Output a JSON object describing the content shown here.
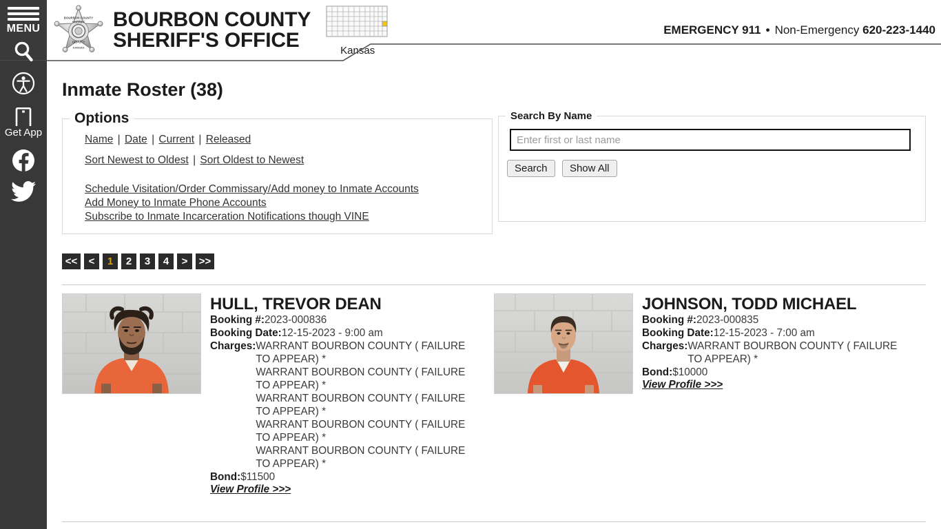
{
  "sidebar": {
    "menu_label": "MENU",
    "items": [
      {
        "name": "menu",
        "label": "MENU",
        "icon": "hamburger-icon"
      },
      {
        "name": "search",
        "label": "",
        "icon": "search-icon"
      },
      {
        "name": "accessibility",
        "label": "",
        "icon": "accessibility-icon"
      },
      {
        "name": "get-app",
        "label": "Get App",
        "icon": "mobile-app-icon"
      },
      {
        "name": "facebook",
        "label": "",
        "icon": "facebook-icon"
      },
      {
        "name": "twitter",
        "label": "",
        "icon": "twitter-icon"
      }
    ],
    "get_app_label": "Get App"
  },
  "header": {
    "badge_alt": "sheriff-star-badge",
    "title_line1": "BOURBON COUNTY",
    "title_line2": "SHERIFF'S OFFICE",
    "state_caption": "Kansas",
    "emergency_label": "EMERGENCY 911",
    "separator": "•",
    "non_emergency_label": "Non-Emergency",
    "non_emergency_number": "620-223-1440",
    "highlight_color": "#f0c419"
  },
  "page": {
    "title": "Inmate Roster (38)"
  },
  "options": {
    "legend": "Options",
    "filters": [
      {
        "label": "Name"
      },
      {
        "label": "Date"
      },
      {
        "label": "Current"
      },
      {
        "label": "Released"
      }
    ],
    "separator": "|",
    "sorts": [
      {
        "label": "Sort Newest to Oldest"
      },
      {
        "label": "Sort Oldest to Newest"
      }
    ],
    "links": [
      {
        "label": "Schedule Visitation/Order Commissary/Add money to Inmate Accounts"
      },
      {
        "label": "Add Money to Inmate Phone Accounts"
      },
      {
        "label": "Subscribe to Inmate Incarceration Notifications though VINE"
      }
    ]
  },
  "search": {
    "legend": "Search By Name",
    "placeholder": "Enter first or last name",
    "value": "",
    "search_button": "Search",
    "show_all_button": "Show All"
  },
  "pagination": {
    "active_color": "#d9a400",
    "items": [
      {
        "label": "<<",
        "active": false,
        "wide": true
      },
      {
        "label": "<",
        "active": false,
        "wide": false
      },
      {
        "label": "1",
        "active": true,
        "wide": false
      },
      {
        "label": "2",
        "active": false,
        "wide": false
      },
      {
        "label": "3",
        "active": false,
        "wide": false
      },
      {
        "label": "4",
        "active": false,
        "wide": false
      },
      {
        "label": ">",
        "active": false,
        "wide": false
      },
      {
        "label": ">>",
        "active": false,
        "wide": true
      }
    ]
  },
  "labels": {
    "booking_no": "Booking #:",
    "booking_date": "Booking Date:",
    "charges": "Charges:",
    "bond": "Bond:",
    "view_profile": "View Profile >>>"
  },
  "inmates": [
    {
      "name": "HULL, TREVOR DEAN",
      "booking_number": "2023-000836",
      "booking_date": "12-15-2023 - 9:00 am",
      "charges": [
        "WARRANT BOURBON COUNTY ( FAILURE TO APPEAR) *",
        "WARRANT BOURBON COUNTY ( FAILURE TO APPEAR) *",
        "WARRANT BOURBON COUNTY ( FAILURE TO APPEAR) *",
        "WARRANT BOURBON COUNTY ( FAILURE TO APPEAR) *",
        "WARRANT BOURBON COUNTY ( FAILURE TO APPEAR) *"
      ],
      "bond": "$11500",
      "view_profile": "View Profile >>>",
      "mugshot_alt": "mugshot-hull-trevor-dean"
    },
    {
      "name": "JOHNSON, TODD MICHAEL",
      "booking_number": "2023-000835",
      "booking_date": "12-15-2023 - 7:00 am",
      "charges": [
        "WARRANT BOURBON COUNTY ( FAILURE TO APPEAR) *"
      ],
      "bond": "$10000",
      "view_profile": "View Profile >>>",
      "mugshot_alt": "mugshot-johnson-todd-michael"
    }
  ]
}
